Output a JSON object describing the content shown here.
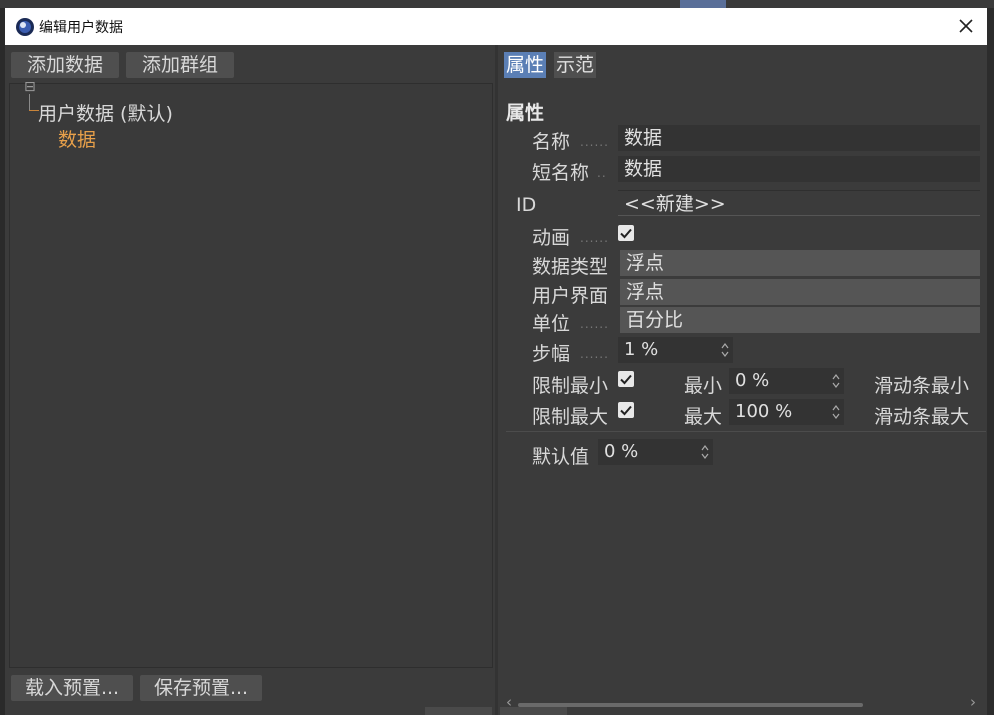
{
  "window": {
    "title": "编辑用户数据",
    "close_label": "×"
  },
  "left": {
    "add_data_button": "添加数据",
    "add_group_button": "添加群组",
    "tree": {
      "root_label": "用户数据 (默认)",
      "child_label": "数据",
      "expand_glyph": "⊟"
    },
    "load_preset_button": "载入预置...",
    "save_preset_button": "保存预置..."
  },
  "right": {
    "tabs": [
      {
        "label": "属性",
        "active": true
      },
      {
        "label": "示范",
        "active": false
      }
    ],
    "section_title": "属性",
    "fields": {
      "name": {
        "label": "名称",
        "dots": "......",
        "value": "数据"
      },
      "short_name": {
        "label": "短名称",
        "dots": "..",
        "value": "数据"
      },
      "id": {
        "label": "ID",
        "value": "<<新建>>"
      },
      "animation": {
        "label": "动画",
        "dots": "......",
        "checked": true
      },
      "data_type": {
        "label": "数据类型",
        "value": "浮点"
      },
      "ui": {
        "label": "用户界面",
        "value": "浮点"
      },
      "unit": {
        "label": "单位",
        "dots": "......",
        "value": "百分比"
      },
      "step": {
        "label": "步幅",
        "dots": "......",
        "value": "1 %"
      },
      "limit_min": {
        "label": "限制最小",
        "checked": true,
        "min_label": "最小",
        "min_value": "0 %",
        "slider_label": "滑动条最小"
      },
      "limit_max": {
        "label": "限制最大",
        "checked": true,
        "max_label": "最大",
        "max_value": "100 %",
        "slider_label": "滑动条最大"
      },
      "default": {
        "label": "默认值",
        "value": "0 %"
      }
    },
    "scroll_left": "‹",
    "scroll_right": "›"
  },
  "colors": {
    "accent": "#5b7fb5",
    "tree_child": "#e8a04a",
    "panel": "#3b3b3b"
  }
}
